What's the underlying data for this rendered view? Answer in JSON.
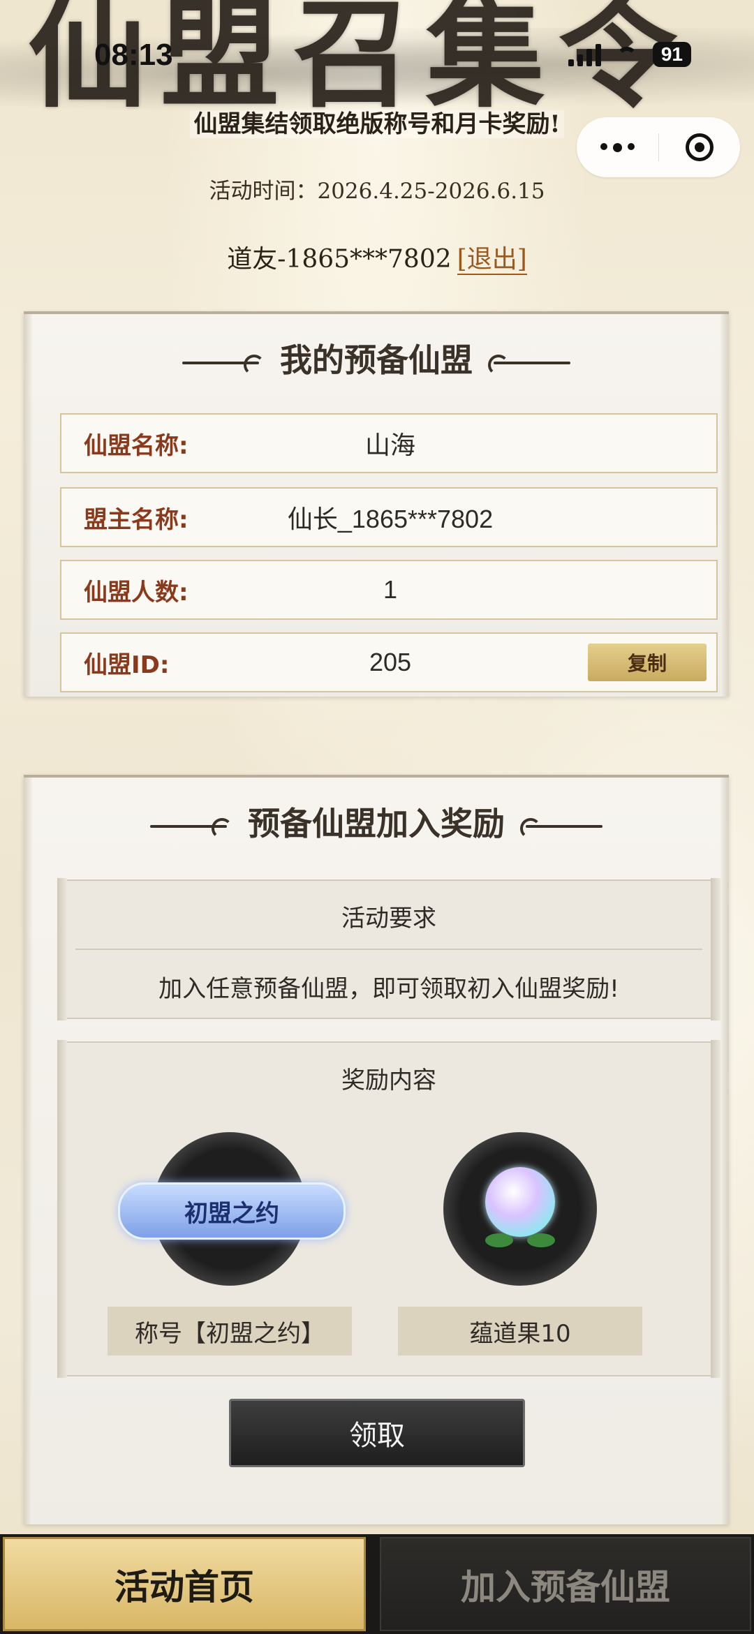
{
  "status_bar": {
    "time": "08:13",
    "battery": "91"
  },
  "header": {
    "banner_text": "仙盟召集令",
    "subtitle": "仙盟集结领取绝版称号和月卡奖励!",
    "activity_time": "活动时间：2026.4.25-2026.6.15",
    "user": "道友-1865***7802",
    "logout": "[退出]"
  },
  "my_alliance": {
    "title": "我的预备仙盟",
    "rows": [
      {
        "label": "仙盟名称:",
        "value": "山海"
      },
      {
        "label": "盟主名称:",
        "value": "仙长_1865***7802"
      },
      {
        "label": "仙盟人数:",
        "value": "1"
      },
      {
        "label": "仙盟ID:",
        "value": "205"
      }
    ],
    "copy_button": "复制"
  },
  "rewards_panel": {
    "title": "预备仙盟加入奖励",
    "requirement_head": "活动要求",
    "requirement_text": "加入任意预备仙盟，即可领取初入仙盟奖励!",
    "reward_head": "奖励内容",
    "rewards": [
      {
        "badge": "初盟之约",
        "label": "称号【初盟之约】",
        "icon": "title-badge-icon"
      },
      {
        "label": "蕴道果10",
        "icon": "peach-fruit-icon"
      }
    ],
    "claim_button": "领取"
  },
  "bottom_nav": {
    "home": "活动首页",
    "join": "加入预备仙盟"
  }
}
